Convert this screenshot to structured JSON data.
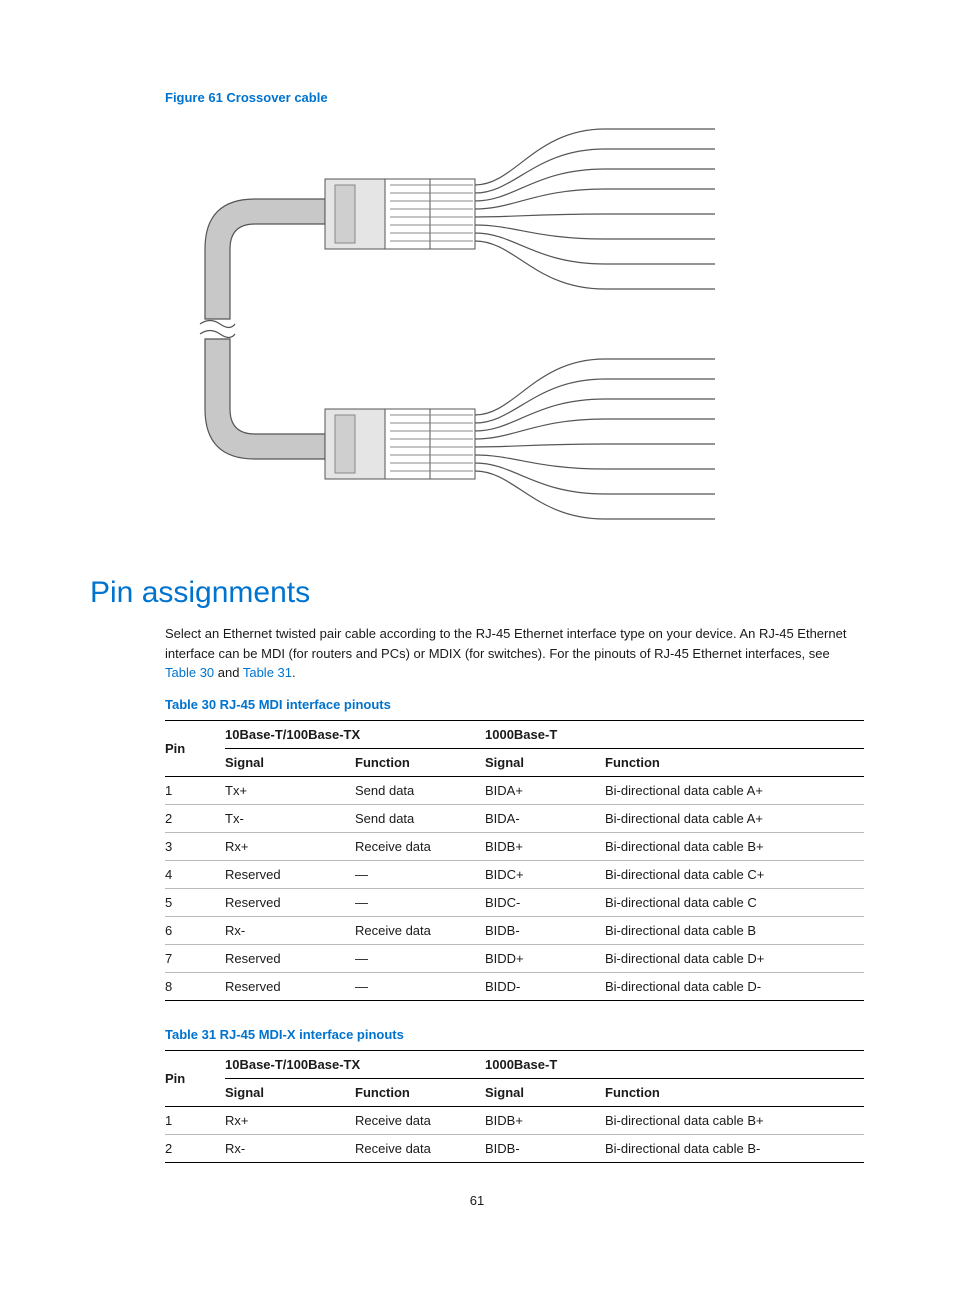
{
  "figure": {
    "caption": "Figure 61 Crossover cable"
  },
  "heading": "Pin assignments",
  "paragraph_parts": {
    "p1": "Select an Ethernet twisted pair cable according to the RJ-45 Ethernet interface type on your device. An RJ-45 Ethernet interface can be MDI (for routers and PCs) or MDIX (for switches). For the pinouts of RJ-45 Ethernet interfaces, see ",
    "ref1": "Table 30",
    "p2": " and ",
    "ref2": "Table 31",
    "p3": "."
  },
  "table30": {
    "caption": "Table 30 RJ-45 MDI interface pinouts",
    "groupA": "10Base-T/100Base-TX",
    "groupB": "1000Base-T",
    "head_pin": "Pin",
    "head_signal": "Signal",
    "head_function": "Function",
    "rows": [
      {
        "pin": "1",
        "sigA": "Tx+",
        "funA": "Send data",
        "sigB": "BIDA+",
        "funB": "Bi-directional data cable A+"
      },
      {
        "pin": "2",
        "sigA": "Tx-",
        "funA": "Send data",
        "sigB": "BIDA-",
        "funB": "Bi-directional data cable A+"
      },
      {
        "pin": "3",
        "sigA": "Rx+",
        "funA": "Receive data",
        "sigB": "BIDB+",
        "funB": "Bi-directional data cable B+"
      },
      {
        "pin": "4",
        "sigA": "Reserved",
        "funA": "—",
        "sigB": "BIDC+",
        "funB": "Bi-directional data cable C+"
      },
      {
        "pin": "5",
        "sigA": "Reserved",
        "funA": "—",
        "sigB": "BIDC-",
        "funB": "Bi-directional data cable C"
      },
      {
        "pin": "6",
        "sigA": "Rx-",
        "funA": "Receive data",
        "sigB": "BIDB-",
        "funB": "Bi-directional data cable B"
      },
      {
        "pin": "7",
        "sigA": "Reserved",
        "funA": "—",
        "sigB": "BIDD+",
        "funB": "Bi-directional data cable D+"
      },
      {
        "pin": "8",
        "sigA": "Reserved",
        "funA": "—",
        "sigB": "BIDD-",
        "funB": "Bi-directional data cable D-"
      }
    ]
  },
  "table31": {
    "caption": "Table 31 RJ-45 MDI-X interface pinouts",
    "groupA": "10Base-T/100Base-TX",
    "groupB": "1000Base-T",
    "head_pin": "Pin",
    "head_signal": "Signal",
    "head_function": "Function",
    "rows": [
      {
        "pin": "1",
        "sigA": "Rx+",
        "funA": "Receive data",
        "sigB": "BIDB+",
        "funB": "Bi-directional data cable B+"
      },
      {
        "pin": "2",
        "sigA": "Rx-",
        "funA": "Receive data",
        "sigB": "BIDB-",
        "funB": "Bi-directional data cable B-"
      }
    ]
  },
  "page_number": "61"
}
